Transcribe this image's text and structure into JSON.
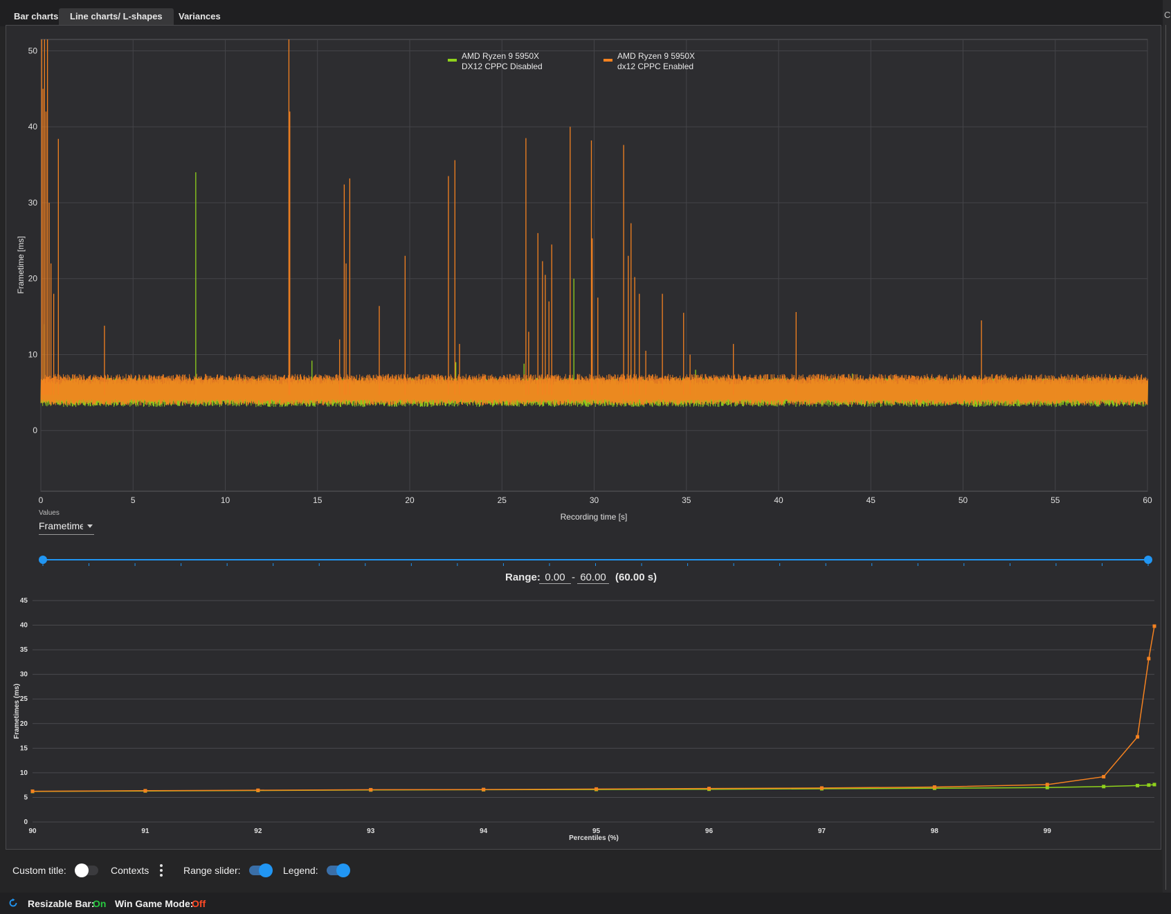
{
  "tabs": [
    {
      "label": "Bar charts",
      "active": false
    },
    {
      "label": "Line charts/ L-shapes",
      "active": true
    },
    {
      "label": "Variances",
      "active": false
    }
  ],
  "right_edge_letter": "C",
  "colors": {
    "series_disabled": "#8fd21c",
    "series_enabled": "#f58220",
    "accent": "#2196f3",
    "on": "#28c940",
    "off": "#ff4a26"
  },
  "chart_data": [
    {
      "type": "line",
      "ylabel": "Frametime [ms]",
      "xlabel": "Recording time [s]",
      "xlim": [
        0,
        60
      ],
      "ylim": [
        -8,
        51.5
      ],
      "xticks": [
        0,
        5,
        10,
        15,
        20,
        25,
        30,
        35,
        40,
        45,
        50,
        55,
        60
      ],
      "yticks": [
        0,
        10,
        20,
        30,
        40,
        50
      ],
      "grid": true,
      "legend_placement": "top-center",
      "series": [
        {
          "name": "AMD Ryzen 9 5950X DX12 CPPC Disabled",
          "legend_lines": [
            "AMD Ryzen 9 5950X",
            "DX12 CPPC Disabled"
          ],
          "color": "#8fd21c",
          "band": [
            3.5,
            6.5
          ],
          "spikes": [
            [
              0.2,
              14
            ],
            [
              8.4,
              34
            ],
            [
              14.7,
              9.2
            ],
            [
              22.5,
              9
            ],
            [
              26.2,
              8.8
            ],
            [
              28.9,
              20
            ],
            [
              32.0,
              8
            ],
            [
              35.5,
              8
            ],
            [
              44,
              7.5
            ],
            [
              51,
              7.5
            ]
          ]
        },
        {
          "name": "AMD Ryzen 9 5950X dx12 CPPC Enabled",
          "legend_lines": [
            "AMD Ryzen 9 5950X",
            "dx12 CPPC Enabled"
          ],
          "color": "#f58220",
          "band": [
            3.7,
            7.0
          ],
          "spikes": [
            [
              0.05,
              51.5
            ],
            [
              0.12,
              45
            ],
            [
              0.2,
              51.5
            ],
            [
              0.28,
              42
            ],
            [
              0.36,
              51.5
            ],
            [
              0.45,
              30
            ],
            [
              0.55,
              22
            ],
            [
              0.7,
              18
            ],
            [
              0.95,
              38.4
            ],
            [
              3.45,
              13.8
            ],
            [
              13.45,
              51.5
            ],
            [
              13.5,
              42
            ],
            [
              16.2,
              12
            ],
            [
              16.45,
              32.4
            ],
            [
              16.55,
              22
            ],
            [
              16.75,
              33.2
            ],
            [
              18.35,
              16.4
            ],
            [
              19.75,
              23
            ],
            [
              22.1,
              33.5
            ],
            [
              22.45,
              35.6
            ],
            [
              22.7,
              11.4
            ],
            [
              26.3,
              38.5
            ],
            [
              26.45,
              13
            ],
            [
              26.95,
              26
            ],
            [
              27.2,
              22.3
            ],
            [
              27.35,
              20.5
            ],
            [
              27.55,
              17
            ],
            [
              27.7,
              24.5
            ],
            [
              28.7,
              40
            ],
            [
              29.85,
              38.2
            ],
            [
              29.9,
              25.3
            ],
            [
              30.2,
              17.5
            ],
            [
              31.6,
              37.6
            ],
            [
              31.85,
              23
            ],
            [
              32.0,
              27.3
            ],
            [
              32.2,
              20.2
            ],
            [
              32.45,
              18
            ],
            [
              32.8,
              10.5
            ],
            [
              33.7,
              18
            ],
            [
              34.85,
              15.5
            ],
            [
              35.2,
              10
            ],
            [
              37.55,
              11.4
            ],
            [
              40.95,
              15.6
            ],
            [
              51.0,
              14.5
            ]
          ]
        }
      ]
    },
    {
      "type": "line",
      "ylabel": "Frametimes (ms)",
      "xlabel": "Percentiles (%)",
      "xlim": [
        90,
        99.95
      ],
      "ylim": [
        0,
        45
      ],
      "xticks": [
        90,
        91,
        92,
        93,
        94,
        95,
        96,
        97,
        98,
        99
      ],
      "yticks": [
        0,
        5,
        10,
        15,
        20,
        25,
        30,
        35,
        40,
        45
      ],
      "grid": true,
      "series": [
        {
          "name": "AMD Ryzen 9 5950X DX12 CPPC Disabled",
          "color": "#8fd21c",
          "x": [
            90,
            91,
            92,
            93,
            94,
            95,
            96,
            97,
            98,
            99,
            99.5,
            99.8,
            99.9,
            99.95
          ],
          "y": [
            6.2,
            6.3,
            6.4,
            6.5,
            6.55,
            6.6,
            6.65,
            6.75,
            6.85,
            7.0,
            7.2,
            7.4,
            7.5,
            7.6
          ]
        },
        {
          "name": "AMD Ryzen 9 5950X dx12 CPPC Enabled",
          "color": "#f58220",
          "x": [
            90,
            91,
            92,
            93,
            94,
            95,
            96,
            97,
            98,
            99,
            99.5,
            99.8,
            99.9,
            99.95
          ],
          "y": [
            6.25,
            6.35,
            6.45,
            6.55,
            6.6,
            6.7,
            6.8,
            6.9,
            7.1,
            7.6,
            9.2,
            17.3,
            33.2,
            39.8
          ]
        }
      ]
    }
  ],
  "values_control": {
    "label": "Values",
    "selected": "Frametime"
  },
  "range": {
    "label": "Range:",
    "from": "0.00",
    "separator": "-",
    "to": "60.00",
    "duration": "(60.00 s)",
    "min": 0,
    "max": 60,
    "lo": 0,
    "hi": 60
  },
  "toggles": {
    "custom_title": {
      "label": "Custom title:",
      "on": false
    },
    "contexts": {
      "label": "Contexts"
    },
    "range_slider": {
      "label": "Range slider:",
      "on": true
    },
    "legend": {
      "label": "Legend:",
      "on": true
    }
  },
  "status": {
    "resizable_bar_label": "Resizable Bar:",
    "resizable_bar_value": "On",
    "win_game_mode_label": "Win Game Mode:",
    "win_game_mode_value": "Off"
  }
}
